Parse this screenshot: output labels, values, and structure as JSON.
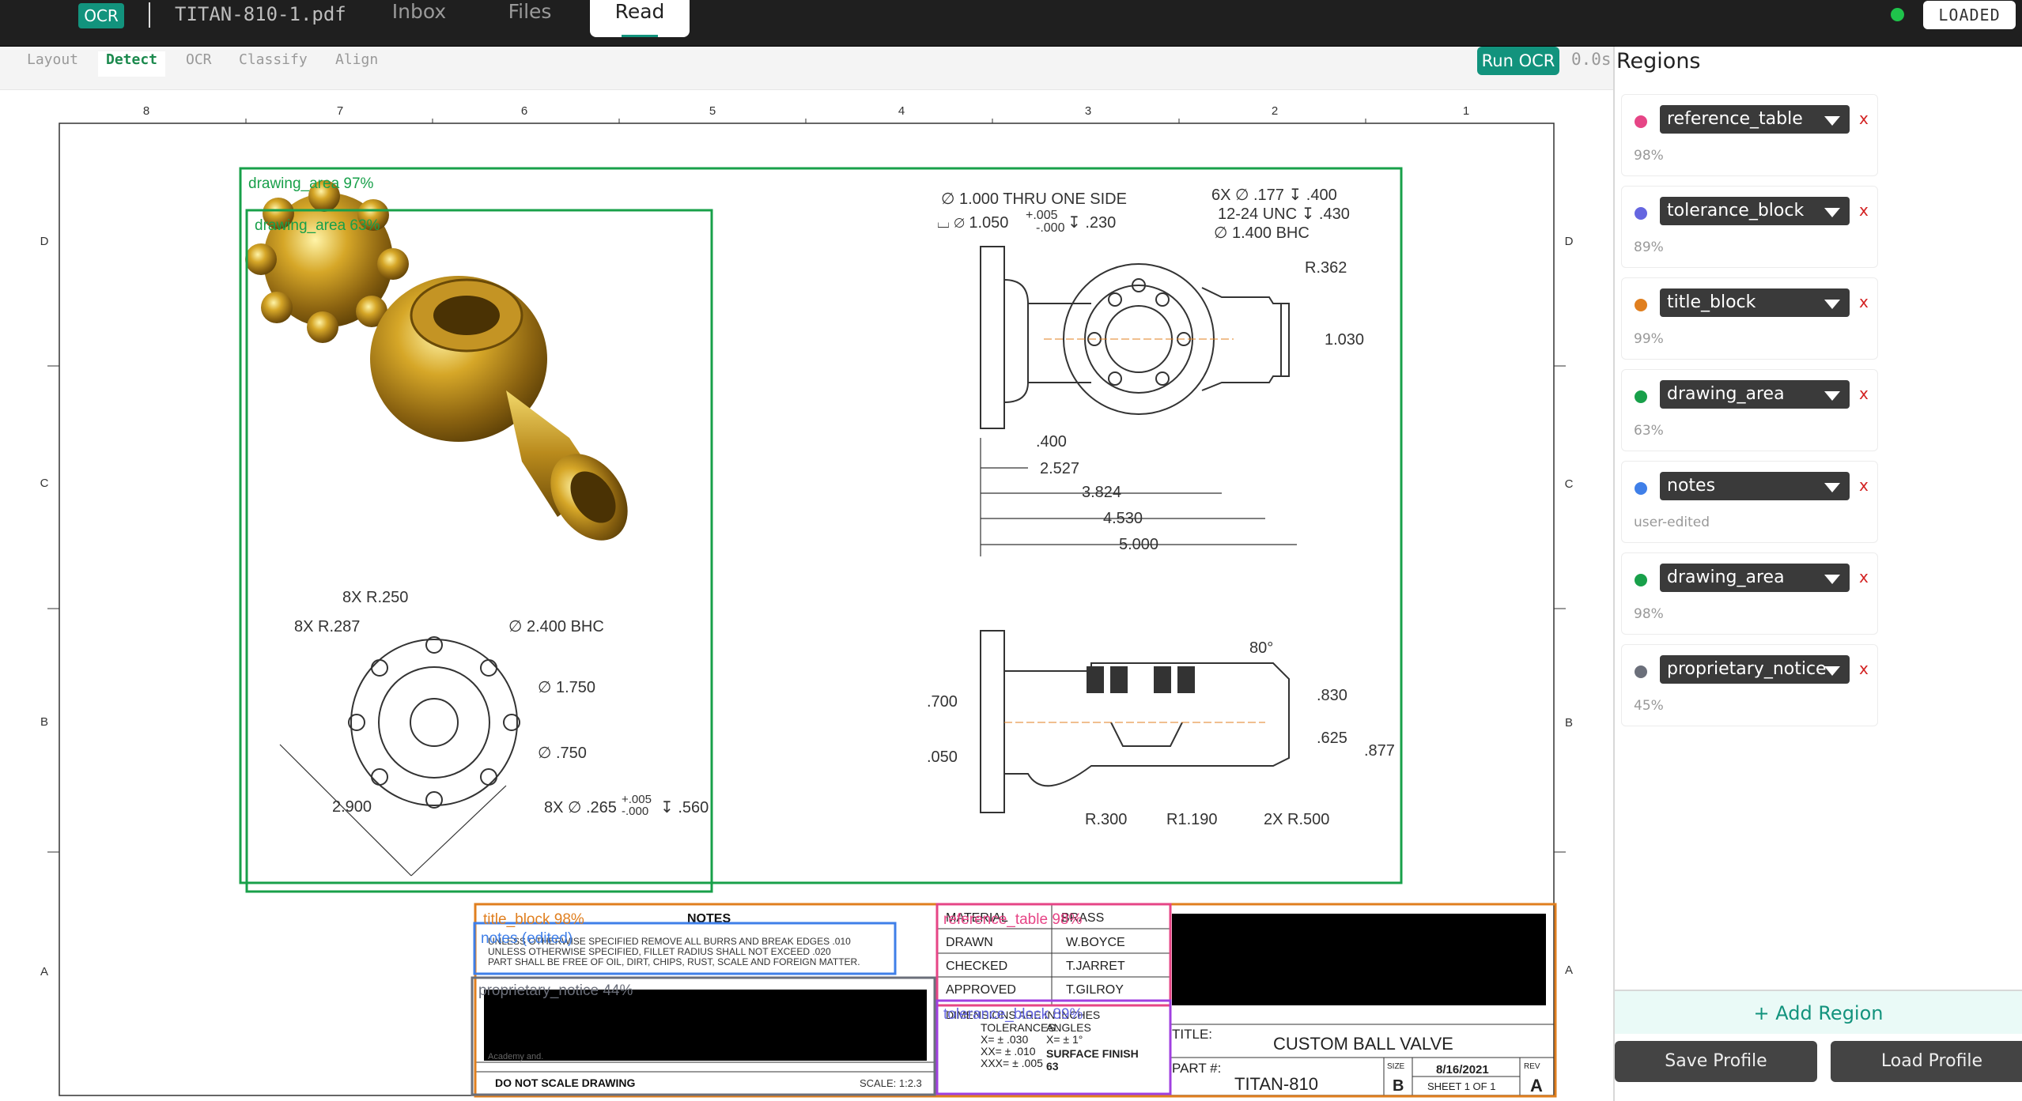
{
  "topbar": {
    "ocr_badge": "OCR",
    "filename": "TITAN-810-1.pdf",
    "tabs": [
      {
        "label": "Inbox"
      },
      {
        "label": "Files"
      },
      {
        "label": "Read"
      }
    ],
    "status": "LOADED",
    "status_color": "#1fc34b"
  },
  "toolbar": {
    "tools": [
      {
        "label": "Layout"
      },
      {
        "label": "Detect"
      },
      {
        "label": "OCR"
      },
      {
        "label": "Classify"
      },
      {
        "label": "Align"
      }
    ],
    "run_ocr": "Run OCR",
    "timer": "0.0s"
  },
  "sidebar": {
    "title": "Regions",
    "regions": [
      {
        "label": "reference_table",
        "confidence": "98%",
        "color": "#e64586"
      },
      {
        "label": "tolerance_block",
        "confidence": "89%",
        "color": "#6566e0"
      },
      {
        "label": "title_block",
        "confidence": "99%",
        "color": "#e07f1f"
      },
      {
        "label": "drawing_area",
        "confidence": "63%",
        "color": "#18a04a"
      },
      {
        "label": "notes",
        "confidence": "user-edited",
        "color": "#3f7fe8"
      },
      {
        "label": "drawing_area",
        "confidence": "98%",
        "color": "#18a04a"
      },
      {
        "label": "proprietary_notice",
        "confidence": "45%",
        "color": "#6b6f7a"
      }
    ],
    "remove": "x",
    "add_region": "+ Add Region",
    "save_profile": "Save Profile",
    "load_profile": "Load Profile"
  },
  "overlays": {
    "drawing_area_outer": "drawing_area 97%",
    "drawing_area_inner": "drawing_area 63%",
    "title_block": "title_block 98%",
    "notes": "notes (edited)",
    "proprietary_notice": "proprietary_notice 44%",
    "reference_table": "reference_table 98%",
    "tolerance_block": "tolerance_block 89%"
  },
  "drawing": {
    "ruler_top": [
      "8",
      "7",
      "6",
      "5",
      "4",
      "3",
      "2",
      "1"
    ],
    "ruler_side": [
      "D",
      "C",
      "B",
      "A"
    ],
    "side_view_dims": {
      "hole_note_1": "∅ 1.000 THRU ONE SIDE",
      "cbore": "⌴ ∅ 1.050",
      "cbore_tol_plus": "+.005",
      "cbore_tol_minus": "-.000",
      "cbore_depth": "↧ .230",
      "tap_1": "6X ∅ .177 ↧ .400",
      "tap_2": "12-24 UNC ↧ .430",
      "bhc": "∅ 1.400 BHC",
      "radius": "R.362",
      "dia_end": "1.030",
      "d400": ".400",
      "d2527": "2.527",
      "d3824": "3.824",
      "d4530": "4.530",
      "d5000": "5.000"
    },
    "section_dims": {
      "angle": "80°",
      "d830": ".830",
      "d625": ".625",
      "d877": ".877",
      "d700": ".700",
      "d050": ".050",
      "r300": "R.300",
      "r1190": "R1.190",
      "r500": "2X R.500"
    },
    "flange_dims": {
      "r250": "8X R.250",
      "r287": "8X R.287",
      "bhc": "∅ 2.400 BHC",
      "d1750": "∅ 1.750",
      "d750": "∅ .750",
      "d2900": "2.900",
      "holes": "8X ∅ .265",
      "holes_tol_plus": "+.005",
      "holes_tol_minus": "-.000",
      "holes_depth": "↧ .560"
    },
    "notes": {
      "heading": "NOTES",
      "lines": [
        "UNLESS OTHERWISE SPECIFIED REMOVE ALL BURRS AND BREAK EDGES .010",
        "UNLESS OTHERWISE SPECIFIED, FILLET RADIUS SHALL NOT EXCEED .020",
        "PART SHALL BE FREE OF OIL, DIRT, CHIPS, RUST, SCALE AND FOREIGN MATTER."
      ]
    },
    "proprietary_tail": "Academy and.",
    "do_not_scale": "DO NOT SCALE DRAWING",
    "scale": "SCALE: 1:2.3",
    "ref_table": [
      {
        "k": "MATERIAL",
        "v": "BRASS"
      },
      {
        "k": "DRAWN",
        "v": "W.BOYCE"
      },
      {
        "k": "CHECKED",
        "v": "T.JARRET"
      },
      {
        "k": "APPROVED",
        "v": "T.GILROY"
      }
    ],
    "tolerance": {
      "heading": "DIMENSIONS ARE IN INCHES",
      "tol": "TOLERANCES:",
      "angles": "ANGLES",
      "x": "X= ± .030",
      "angle_val": "X= ± 1°",
      "xx": "XX= ± .010",
      "xxx": "XXX= ± .005",
      "surface": "SURFACE FINISH",
      "surface_val": "63"
    },
    "title": {
      "label": "TITLE:",
      "value": "CUSTOM BALL VALVE",
      "part_label": "PART #:",
      "part_value": "TITAN-810",
      "size_label": "SIZE",
      "size_value": "B",
      "date": "8/16/2021",
      "sheet": "SHEET 1 OF 1",
      "rev_label": "REV",
      "rev_value": "A"
    }
  }
}
